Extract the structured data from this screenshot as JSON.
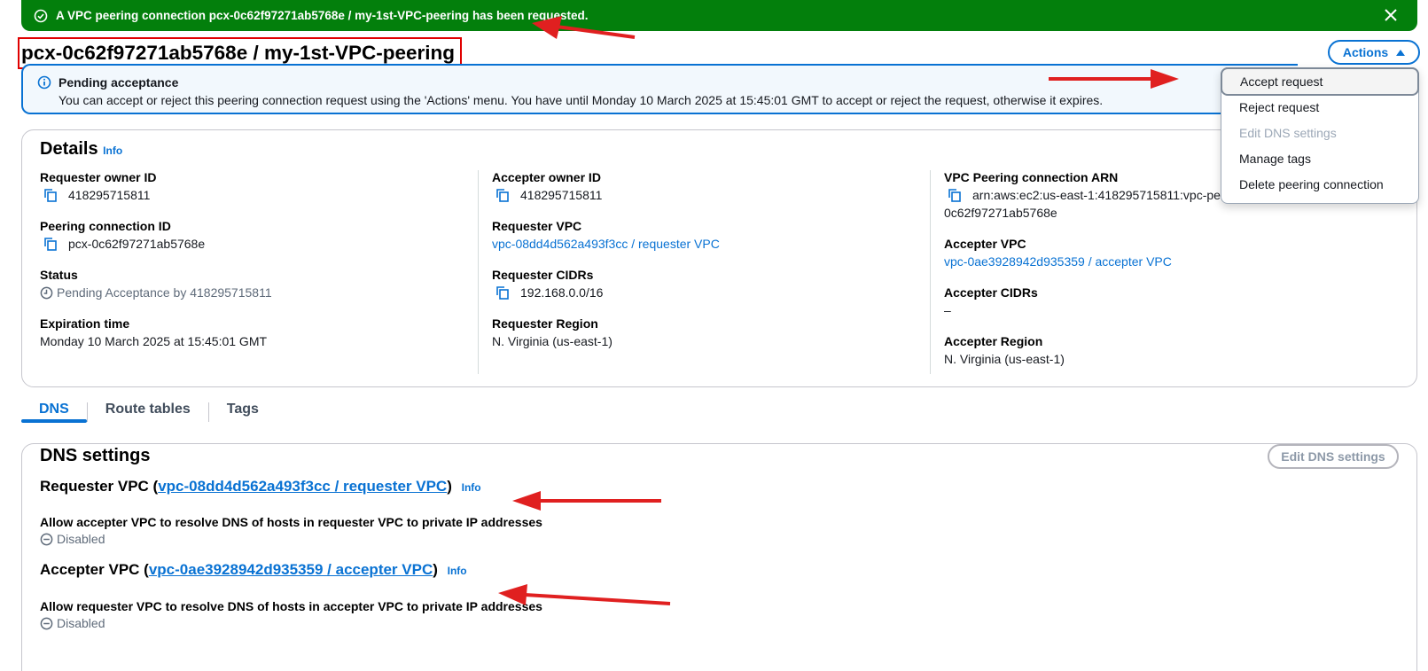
{
  "flash": {
    "message_prefix": "A VPC peering connection ",
    "message_id": "pcx-0c62f97271ab5768e / my-1st-VPC-peering",
    "message_suffix": " has been requested.",
    "color": "#037f0c"
  },
  "page_title": "pcx-0c62f97271ab5768e / my-1st-VPC-peering",
  "actions": {
    "label": "Actions",
    "menu": [
      {
        "label": "Accept request",
        "state": "selected"
      },
      {
        "label": "Reject request",
        "state": "enabled"
      },
      {
        "label": "Edit DNS settings",
        "state": "disabled"
      },
      {
        "label": "Manage tags",
        "state": "enabled"
      },
      {
        "label": "Delete peering connection",
        "state": "enabled"
      }
    ]
  },
  "alert": {
    "heading": "Pending acceptance",
    "body": "You can accept or reject this peering connection request using the 'Actions' menu. You have until Monday 10 March 2025 at 15:45:01 GMT to accept or reject the request, otherwise it expires."
  },
  "details": {
    "heading": "Details",
    "info": "Info",
    "col1": {
      "requester_owner_label": "Requester owner ID",
      "requester_owner_value": "418295715811",
      "peering_id_label": "Peering connection ID",
      "peering_id_value": "pcx-0c62f97271ab5768e",
      "status_label": "Status",
      "status_value": "Pending Acceptance by 418295715811",
      "expiration_label": "Expiration time",
      "expiration_value": "Monday 10 March 2025 at 15:45:01 GMT"
    },
    "col2": {
      "accepter_owner_label": "Accepter owner ID",
      "accepter_owner_value": "418295715811",
      "requester_vpc_label": "Requester VPC",
      "requester_vpc_value": "vpc-08dd4d562a493f3cc / requester VPC",
      "requester_cidrs_label": "Requester CIDRs",
      "requester_cidrs_value": "192.168.0.0/16",
      "requester_region_label": "Requester Region",
      "requester_region_value": "N. Virginia (us-east-1)"
    },
    "col3": {
      "arn_label": "VPC Peering connection ARN",
      "arn_line1": "arn:aws:ec2:us-east-1:418295715811:vpc-peering-connection/pcx-",
      "arn_line2": "0c62f97271ab5768e",
      "accepter_vpc_label": "Accepter VPC",
      "accepter_vpc_value": "vpc-0ae3928942d935359 / accepter VPC",
      "accepter_cidrs_label": "Accepter CIDRs",
      "accepter_cidrs_value": "–",
      "accepter_region_label": "Accepter Region",
      "accepter_region_value": "N. Virginia (us-east-1)"
    }
  },
  "tabs": [
    "DNS",
    "Route tables",
    "Tags"
  ],
  "dns": {
    "heading": "DNS settings",
    "edit_button": "Edit DNS settings",
    "requester": {
      "prefix": "Requester VPC (",
      "link": "vpc-08dd4d562a493f3cc / requester VPC",
      "suffix": ")",
      "info": "Info",
      "allow_label": "Allow accepter VPC to resolve DNS of hosts in requester VPC to private IP addresses",
      "status": "Disabled"
    },
    "accepter": {
      "prefix": "Accepter VPC (",
      "link": "vpc-0ae3928942d935359 / accepter VPC",
      "suffix": ")",
      "info": "Info",
      "allow_label": "Allow requester VPC to resolve DNS of hosts in accepter VPC to private IP addresses",
      "status": "Disabled"
    }
  },
  "colors": {
    "link": "#0972d3",
    "annotation_arrow": "#e02020",
    "title_highlight_box": "#e00000"
  }
}
